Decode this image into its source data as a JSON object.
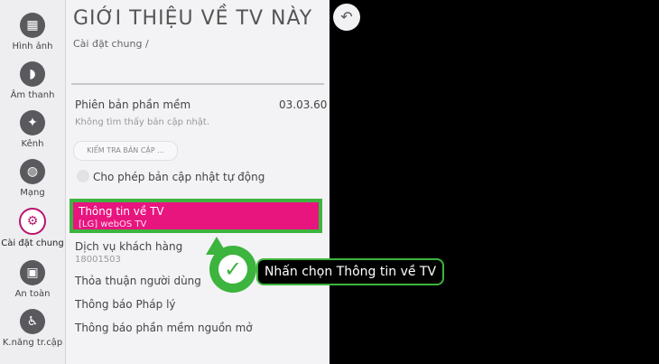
{
  "sidebar": {
    "items": [
      {
        "label": "Hình ảnh",
        "icon": "picture-icon"
      },
      {
        "label": "Âm thanh",
        "icon": "sound-icon"
      },
      {
        "label": "Kênh",
        "icon": "channel-icon"
      },
      {
        "label": "Mạng",
        "icon": "network-icon"
      },
      {
        "label": "Cài đặt chung",
        "icon": "general-settings-icon"
      },
      {
        "label": "An toàn",
        "icon": "lock-icon"
      },
      {
        "label": "K.năng tr.cập",
        "icon": "accessibility-icon"
      }
    ]
  },
  "panel": {
    "title": "GIỚI THIỆU VỀ TV NÀY",
    "breadcrumb": "Cài đặt chung /",
    "software_version_label": "Phiên bản phần mềm",
    "software_version_value": "03.03.60",
    "no_update_text": "Không tìm thấy bản cập nhật.",
    "check_update_button": "KIỂM TRA BẢN CẬP ...",
    "auto_update_label": "Cho phép bản cập nhật tự động",
    "tv_info_label": "Thông tin về TV",
    "tv_info_sub": "[LG] webOS TV",
    "customer_service_label": "Dịch vụ khách hàng",
    "customer_service_sub": "18001503",
    "user_agreement_label": "Thỏa thuận người dùng",
    "legal_notice_label": "Thông báo Pháp lý",
    "open_source_label": "Thông báo phần mềm nguồn mở"
  },
  "callout": {
    "text": "Nhấn chọn Thông tin về TV"
  },
  "colors": {
    "accent": "#e8157f",
    "highlight": "#3db43d"
  }
}
